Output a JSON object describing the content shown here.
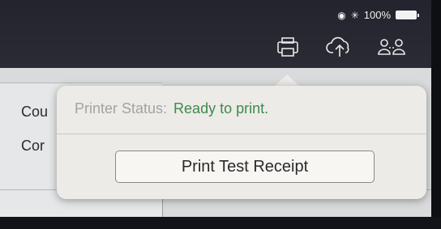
{
  "status_bar": {
    "battery_text": "100%",
    "orientation_lock_icon": "orientation-lock-icon",
    "bluetooth_icon": "bluetooth-icon"
  },
  "toolbar": {
    "icons": [
      "printer-icon",
      "cloud-upload-icon",
      "users-icon"
    ]
  },
  "background_list": {
    "items": [
      "Cou",
      "Cor"
    ]
  },
  "popover": {
    "status_label": "Printer Status:",
    "status_value": "Ready to print.",
    "button_label": "Print Test Receipt"
  },
  "colors": {
    "status_ok": "#3e8a4a",
    "topbar": "#2a2b34",
    "popover_bg": "#ecebe8"
  }
}
